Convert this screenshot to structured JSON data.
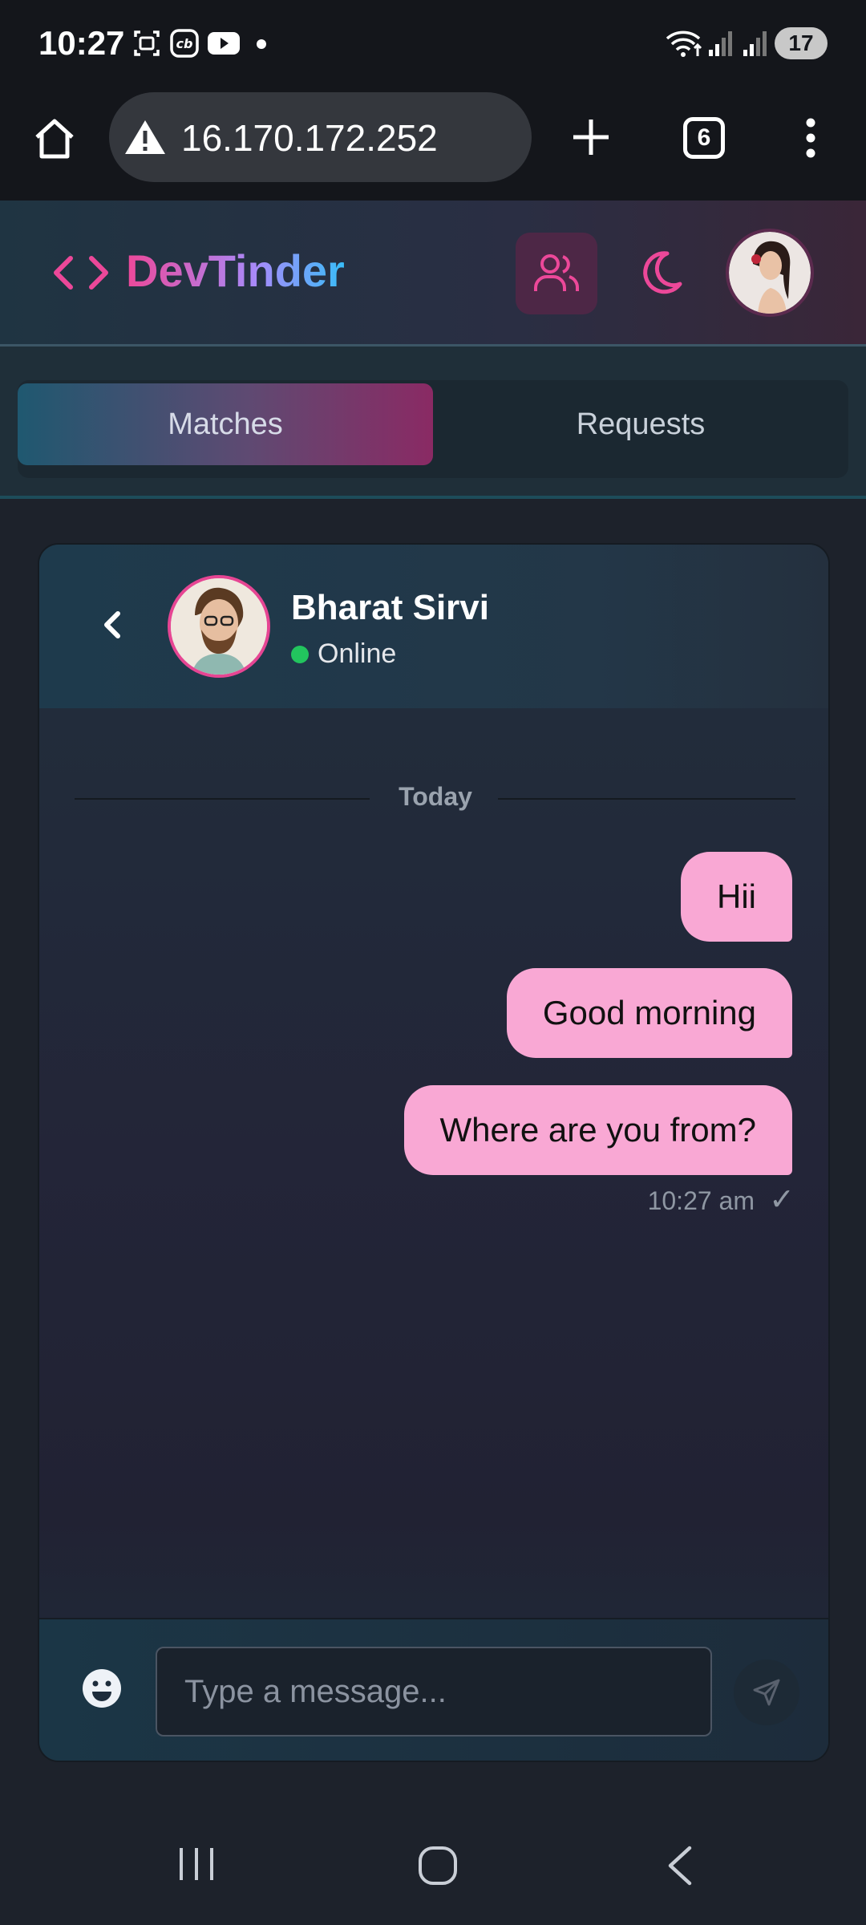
{
  "status_bar": {
    "time": "10:27",
    "battery": "17",
    "icons": [
      "screenshot-icon",
      "cb-app-icon",
      "youtube-icon",
      "dot-icon",
      "wifi-icon",
      "signal-icon",
      "signal-icon"
    ]
  },
  "browser": {
    "url": "16.170.172.252",
    "tab_count": "6",
    "icons": [
      "home-icon",
      "warning-icon",
      "plus-icon",
      "tabs-icon",
      "more-vertical-icon"
    ]
  },
  "app": {
    "logo_text": "DevTinder",
    "logo_icon": "code-icon",
    "connections_icon": "users-icon",
    "theme_icon": "moon-icon",
    "accent": "#ec4899"
  },
  "tabs": [
    {
      "label": "Matches",
      "active": true
    },
    {
      "label": "Requests",
      "active": false
    }
  ],
  "chat": {
    "contact_name": "Bharat Sirvi",
    "contact_status": "Online",
    "status_color": "#22c55e",
    "date_divider": "Today",
    "messages": [
      {
        "text": "Hii",
        "sender": "me"
      },
      {
        "text": "Good morning",
        "sender": "me"
      },
      {
        "text": "Where are you from?",
        "sender": "me"
      }
    ],
    "last_time": "10:27 am",
    "read_mark": "✓",
    "bubble_color": "#f9a8d4",
    "input_placeholder": "Type a message..."
  },
  "nav": {
    "icons": [
      "recent-apps-icon",
      "home-circle-icon",
      "back-icon"
    ]
  }
}
